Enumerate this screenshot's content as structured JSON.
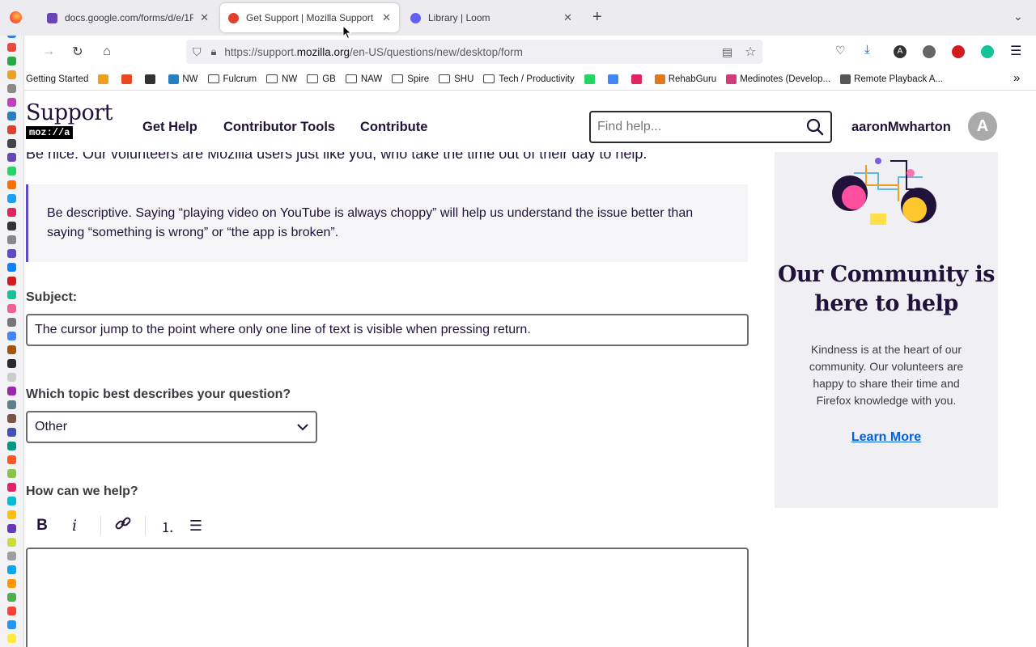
{
  "browser": {
    "tabs": [
      {
        "title": "docs.google.com/forms/d/e/1FAI",
        "favicon_color": "#6a45b5",
        "active": false
      },
      {
        "title": "Get Support | Mozilla Support",
        "favicon_color": "#e0412c",
        "active": true
      },
      {
        "title": "Library | Loom",
        "favicon_color": "#625df5",
        "active": false
      }
    ],
    "new_tab": "+",
    "url_prefix": "https://support.",
    "url_host": "mozilla.org",
    "url_path": "/en-US/questions/new/desktop/form",
    "bookmarks": [
      {
        "label": "Getting Started",
        "kind": "plain"
      },
      {
        "label": "",
        "kind": "icon",
        "color": "#f0a020"
      },
      {
        "label": "",
        "kind": "icon",
        "color": "#e84820"
      },
      {
        "label": "",
        "kind": "icon",
        "color": "#333333"
      },
      {
        "label": "NW",
        "kind": "icon",
        "color": "#2a7fbf"
      },
      {
        "label": "Fulcrum",
        "kind": "folder"
      },
      {
        "label": "NW",
        "kind": "folder"
      },
      {
        "label": "GB",
        "kind": "folder"
      },
      {
        "label": "NAW",
        "kind": "folder"
      },
      {
        "label": "Spire",
        "kind": "folder"
      },
      {
        "label": "SHU",
        "kind": "folder"
      },
      {
        "label": "Tech / Productivity",
        "kind": "folder"
      },
      {
        "label": "",
        "kind": "icon",
        "color": "#25d366"
      },
      {
        "label": "",
        "kind": "icon",
        "color": "#4285f4"
      },
      {
        "label": "",
        "kind": "icon",
        "color": "#e0245e"
      },
      {
        "label": "RehabGuru",
        "kind": "icon",
        "color": "#e07820"
      },
      {
        "label": "Medinotes (Develop...",
        "kind": "icon",
        "color": "#d23c7a"
      },
      {
        "label": "Remote Playback A...",
        "kind": "icon",
        "color": "#555555"
      }
    ]
  },
  "site": {
    "logo_word": "Support",
    "logo_badge": "moz://a",
    "nav": [
      "Get Help",
      "Contributor Tools",
      "Contribute"
    ],
    "search_placeholder": "Find help...",
    "username": "aaronMwharton",
    "avatar_letter": "A"
  },
  "form": {
    "be_nice": "Be nice. Our volunteers are Mozilla users just like you, who take the time out of their day to help.",
    "callout": "Be descriptive. Saying “playing video on YouTube is always choppy” will help us understand the issue better than saying “something is wrong” or “the app is broken”.",
    "subject_label": "Subject:",
    "subject_value": "The cursor jump to the point where only one line of text is visible when pressing return.",
    "topic_label": "Which topic best describes your question?",
    "topic_value": "Other",
    "help_label": "How can we help?",
    "editor_value": ""
  },
  "sidebar": {
    "heading": "Our Community is here to help",
    "body": "Kindness is at the heart of our community. Our volunteers are happy to share their time and Firefox knowledge with you.",
    "link": "Learn More"
  }
}
